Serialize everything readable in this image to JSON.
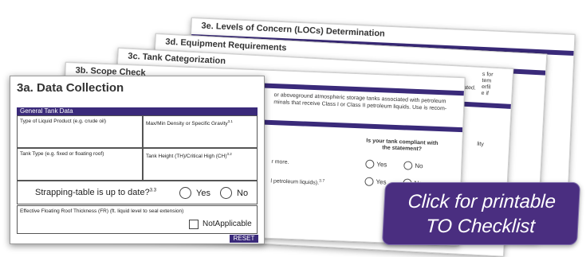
{
  "sheets": {
    "s3e": {
      "title": "3e. Levels of Concern (LOCs) Determination"
    },
    "s3d": {
      "title": "3d. Equipment Requirements"
    },
    "s3c": {
      "title": "3c. Tank Categorization",
      "snippet_right_a": "s for",
      "snippet_right_b": "tem",
      "snippet_right_c": "erfil",
      "snippet_right_d": "e if",
      "snippet_generated": "erated.",
      "snippet_lity": "lity"
    },
    "s3b": {
      "title": "3b. Scope Check",
      "intro": "or aboveground atmospheric storage tanks associated with petroleum minals that receive Class I or Class II petroleum liquids. Use is recom-",
      "question_header": "Is your tank compliant with the statement?",
      "row1_text": "r more.",
      "row2_text": "l petroleum liquids).",
      "row2_sup": "3.7",
      "yes": "Yes",
      "no": "No"
    }
  },
  "front": {
    "title": "3a. Data Collection",
    "section_header": "General Tank Data",
    "cells": {
      "liquid_product": "Type of Liquid Product (e.g. crude oil)",
      "density": "Max/Min Density or Specific Gravity",
      "density_sup": "3.1",
      "tank_type": "Tank Type (e.g. fixed or floating roof)",
      "tank_height": "Tank Height (TH)/Critical High (CH)",
      "tank_height_sup": "3.2"
    },
    "strapping": {
      "label": "Strapping-table is up to date?",
      "sup": "3.3",
      "yes": "Yes",
      "no": "No"
    },
    "floating_roof": {
      "label": "Effective Floating Roof Thickness (FR) (ft. liquid level to seal extension)",
      "na": "NotApplicable"
    },
    "reset": "RESET"
  },
  "banner": {
    "line1": "Click for printable",
    "line2": "TO  Checklist"
  },
  "colors": {
    "brand_purple": "#3a2a7a",
    "banner_purple": "#4a2e80"
  }
}
